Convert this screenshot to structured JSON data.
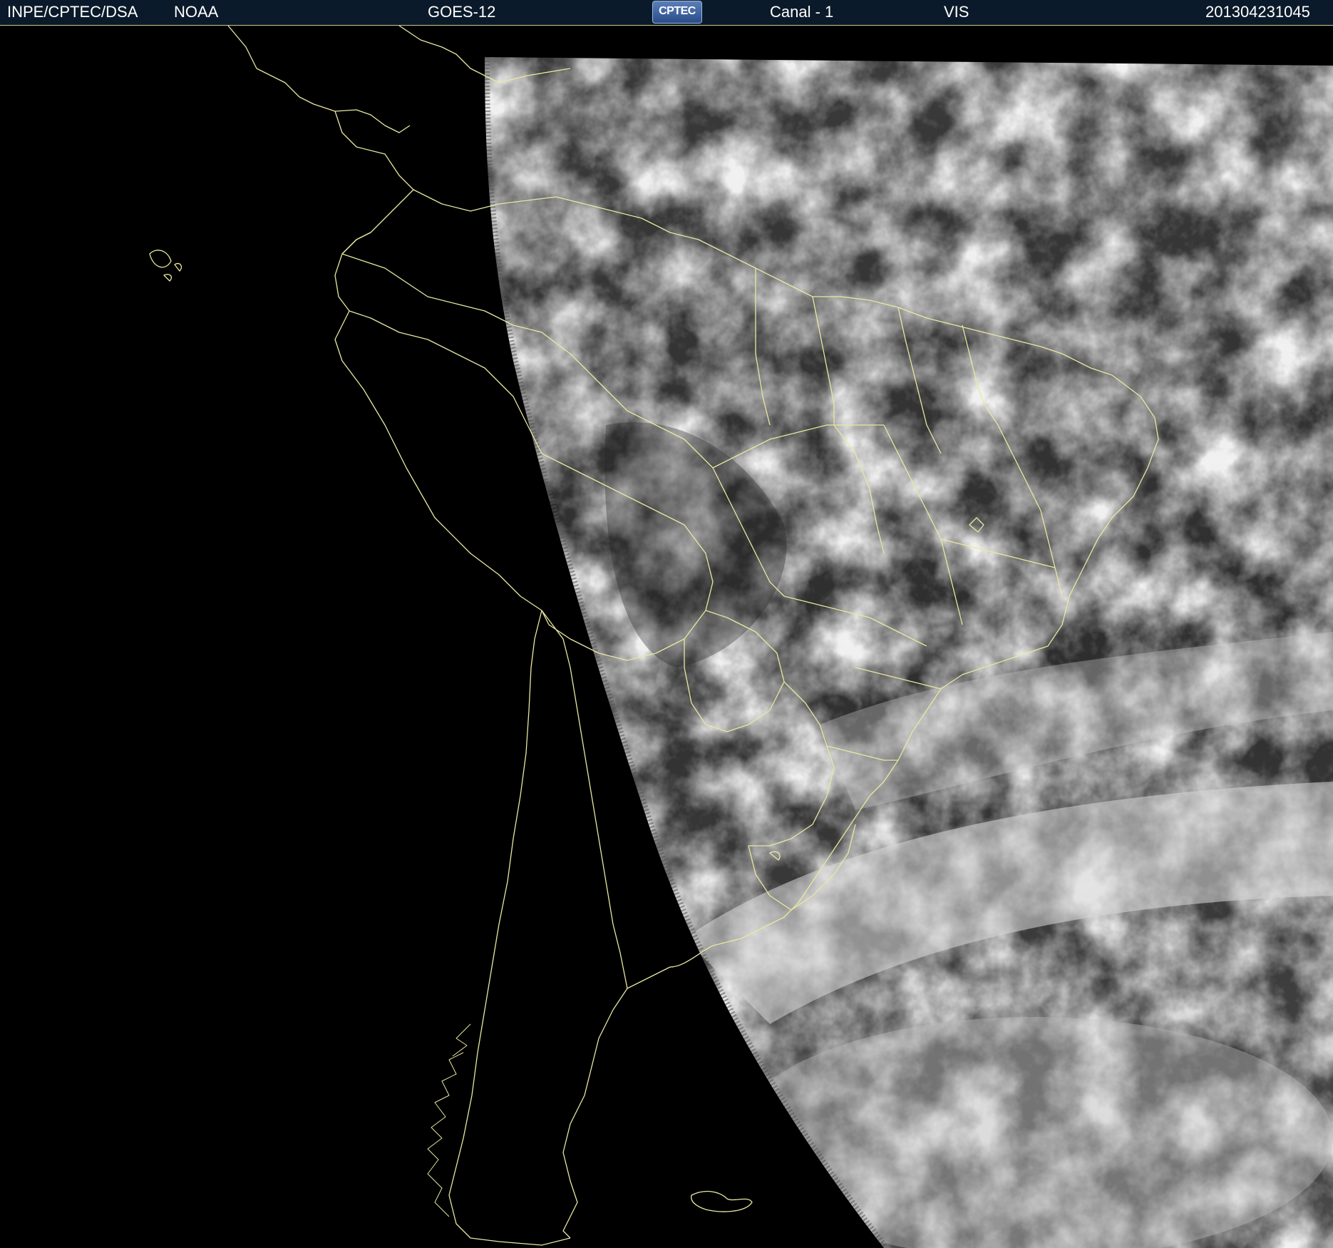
{
  "header": {
    "organization": "INPE/CPTEC/DSA",
    "agency": "NOAA",
    "satellite": "GOES-12",
    "logo_text": "CPTEC",
    "channel": "Canal - 1",
    "band": "VIS",
    "timestamp": "201304231045"
  },
  "colors": {
    "header_background": "#0b1a2a",
    "header_text": "#ffffff",
    "coastline": "#e8e8a0",
    "space": "#000000",
    "cloud": "#f0f0f0"
  },
  "image": {
    "description_type": "satellite-visible-imagery"
  }
}
